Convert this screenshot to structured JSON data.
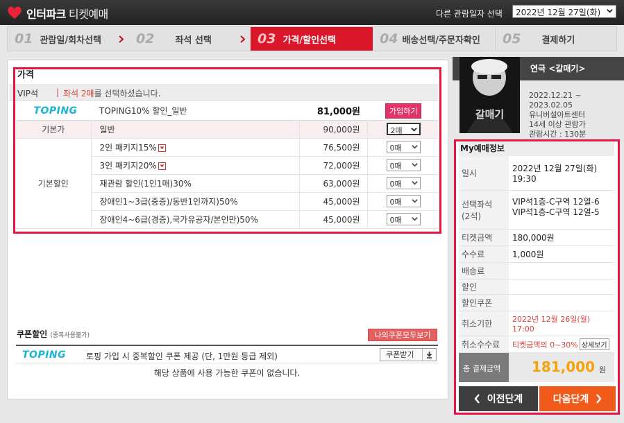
{
  "header": {
    "logo": "인터파크",
    "logo_sub": "티켓예매",
    "date_label": "다른 관람일자 선택",
    "date_value": "2022년 12월 27일(화)"
  },
  "steps": [
    {
      "num": "01",
      "label": "관람일/회차선택"
    },
    {
      "num": "02",
      "label": "좌석 선택"
    },
    {
      "num": "03",
      "label": "가격/할인선택"
    },
    {
      "num": "04",
      "label": "배송선택/주문자확인"
    },
    {
      "num": "05",
      "label": "결제하기"
    }
  ],
  "price_section": {
    "title": "가격",
    "grade": "VIP석",
    "separator": "|",
    "msg_red": "좌석 2매",
    "msg_rest": "를 선택하셨습니다.",
    "topping": {
      "logo": "TOPING",
      "name": "TOPING10% 할인_일반",
      "amount": "81,000원",
      "join_label": "가입하기"
    },
    "base": {
      "category": "기본가",
      "name": "일반",
      "amount": "90,000원",
      "qty": "2매"
    },
    "discount_category": "기본할인",
    "discounts": [
      {
        "name": "2인 패키지15%",
        "amount": "76,500원",
        "qty": "0매"
      },
      {
        "name": "3인 패키지20%",
        "amount": "72,000원",
        "qty": "0매"
      },
      {
        "name": "재관람 할인(1인1매)30%",
        "amount": "63,000원",
        "qty": "0매"
      },
      {
        "name": "장애인1~3급(중증)/동반1인까지)50%",
        "amount": "45,000원",
        "qty": "0매"
      },
      {
        "name": "장애인4~6급(경증),국가유공자/본인만)50%",
        "amount": "45,000원",
        "qty": "0매"
      }
    ]
  },
  "coupon": {
    "title": "쿠폰할인",
    "title_small": "(중복사용불가)",
    "all_button": "나의쿠폰모두보기",
    "logo": "TOPING",
    "desc": "토핑 가입 시 중복할인 쿠폰 제공 (단, 1만원 등급 제외)",
    "receive_button": "쿠폰받기",
    "empty_msg": "해당 상품에 사용 가능한 쿠폰이 없습니다."
  },
  "show": {
    "title": "연극 <갈매기>",
    "poster_text": "갈매기",
    "info": [
      "2022.12.21 ~",
      "2023.02.05",
      "유니버설아트센터",
      "14세 이상 관람가",
      "관람시간 : 130분"
    ]
  },
  "my_booking": {
    "title": "My예매정보",
    "date_label": "일시",
    "date_value": [
      "2022년 12월 27일(화)",
      "19:30"
    ],
    "seats_label": [
      "선택좌석",
      "(2석)"
    ],
    "seats_value": [
      "VIP석1층-C구역 12열-6",
      "VIP석1층-C구역 12열-5"
    ],
    "ticket_label": "티켓금액",
    "ticket_value": "180,000원",
    "fee_label": "수수료",
    "fee_value": "1,000원",
    "delivery_label": "배송료",
    "delivery_value": "",
    "discount_label": "할인",
    "discount_value": "",
    "coupon_label": "할인쿠폰",
    "coupon_value": "",
    "cancel_deadline_label": "취소기한",
    "cancel_deadline_value": [
      "2022년 12월 26일(월)",
      "17:00"
    ],
    "cancel_fee_label": "취소수수료",
    "cancel_fee_value": "티켓금액의 0~30%",
    "detail_button": "상세보기",
    "total_label": "총 결제금액",
    "total_value": "181,000",
    "total_unit": "원"
  },
  "nav": {
    "prev": "이전단계",
    "next": "다음단계"
  },
  "colors": {
    "accent": "#d91729",
    "highlight": "#e8143f",
    "next": "#f05a1a",
    "total": "#f5a30d",
    "topping": "#1bb3d6"
  }
}
